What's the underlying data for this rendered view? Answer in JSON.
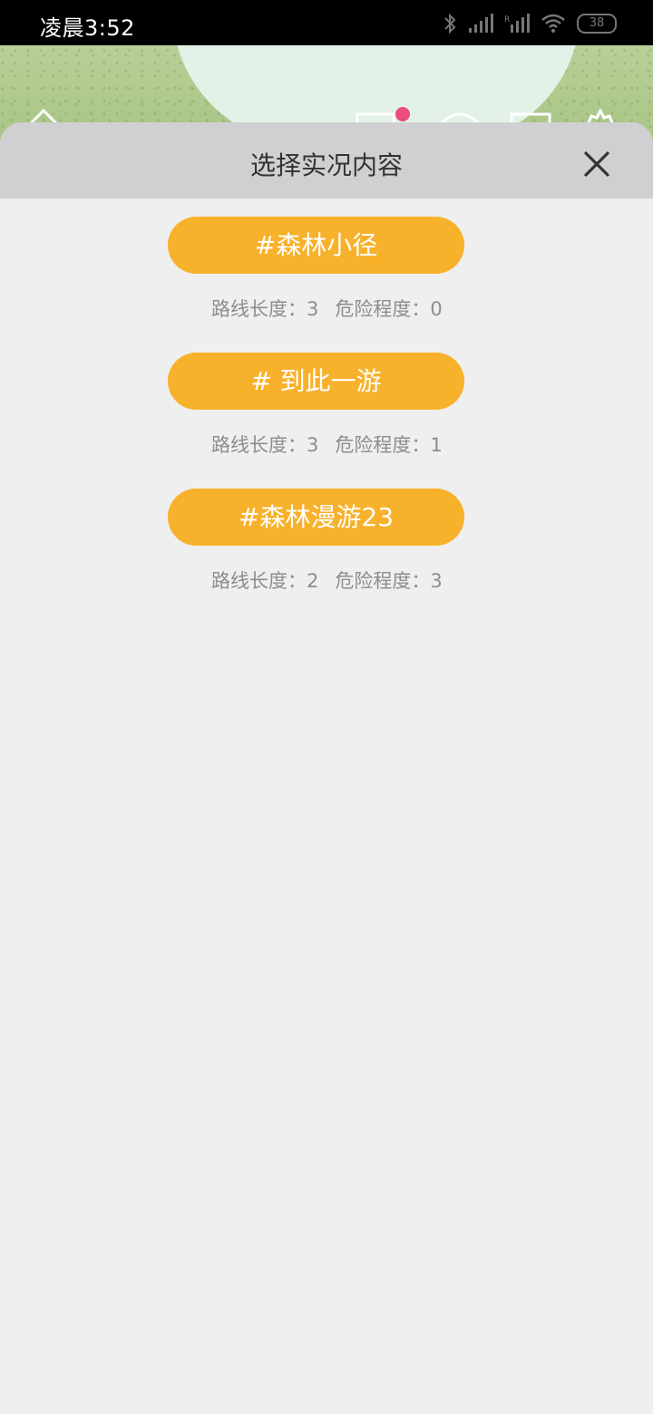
{
  "status_bar": {
    "time": "凌晨3:52",
    "battery": "38",
    "icons": [
      "bluetooth-icon",
      "signal-icon",
      "signal-roaming-icon",
      "wifi-icon",
      "battery-icon"
    ]
  },
  "sheet": {
    "title": "选择实况内容",
    "close_icon": "close-icon"
  },
  "routes": [
    {
      "name": "#森林小径",
      "length_label": "路线长度：",
      "length": "3",
      "danger_label": "危险程度：",
      "danger": "0"
    },
    {
      "name": "# 到此一游",
      "length_label": "路线长度：",
      "length": "3",
      "danger_label": "危险程度：",
      "danger": "1"
    },
    {
      "name": "#森林漫游23",
      "length_label": "路线长度：",
      "length": "2",
      "danger_label": "危险程度：",
      "danger": "3"
    }
  ],
  "colors": {
    "accent": "#f8b12a",
    "header_bg": "#d0d0d2",
    "page_bg": "#efefef",
    "badge": "#ec4c7e"
  }
}
